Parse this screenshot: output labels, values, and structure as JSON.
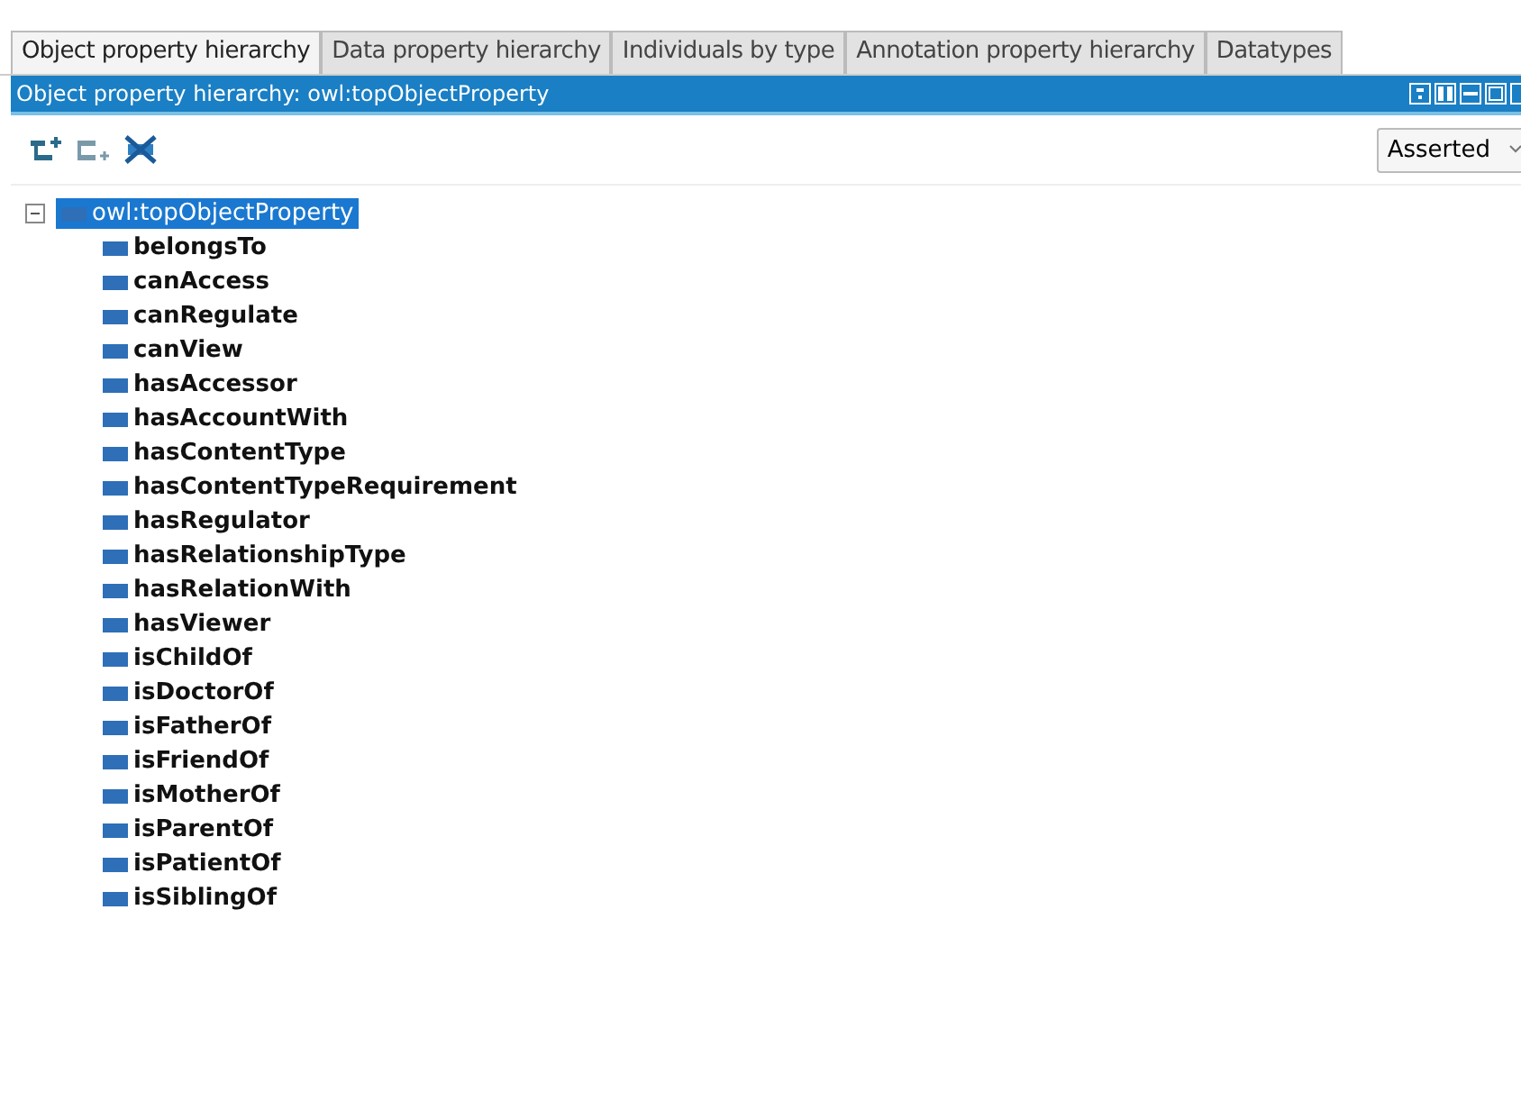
{
  "tabs": [
    {
      "label": "Object property hierarchy",
      "selected": true
    },
    {
      "label": "Data property hierarchy",
      "selected": false
    },
    {
      "label": "Individuals by type",
      "selected": false
    },
    {
      "label": "Annotation property hierarchy",
      "selected": false
    },
    {
      "label": "Datatypes",
      "selected": false
    }
  ],
  "panel": {
    "title": "Object property hierarchy: owl:topObjectProperty",
    "view_select": {
      "value": "Asserted"
    }
  },
  "tree": [
    {
      "label": "owl:topObjectProperty",
      "selected": true,
      "expanded": true,
      "children": [
        {
          "label": "belongsTo",
          "selected": false
        },
        {
          "label": "canAccess",
          "selected": false
        },
        {
          "label": "canRegulate",
          "selected": false
        },
        {
          "label": "canView",
          "selected": false
        },
        {
          "label": "hasAccessor",
          "selected": false
        },
        {
          "label": "hasAccountWith",
          "selected": false
        },
        {
          "label": "hasContentType",
          "selected": false
        },
        {
          "label": "hasContentTypeRequirement",
          "selected": false
        },
        {
          "label": "hasRegulator",
          "selected": false
        },
        {
          "label": "hasRelationshipType",
          "selected": false
        },
        {
          "label": "hasRelationWith",
          "selected": false
        },
        {
          "label": "hasViewer",
          "selected": false
        },
        {
          "label": "isChildOf",
          "selected": false
        },
        {
          "label": "isDoctorOf",
          "selected": false
        },
        {
          "label": "isFatherOf",
          "selected": false
        },
        {
          "label": "isFriendOf",
          "selected": false
        },
        {
          "label": "isMotherOf",
          "selected": false
        },
        {
          "label": "isParentOf",
          "selected": false
        },
        {
          "label": "isPatientOf",
          "selected": false
        },
        {
          "label": "isSiblingOf",
          "selected": false
        }
      ]
    }
  ]
}
